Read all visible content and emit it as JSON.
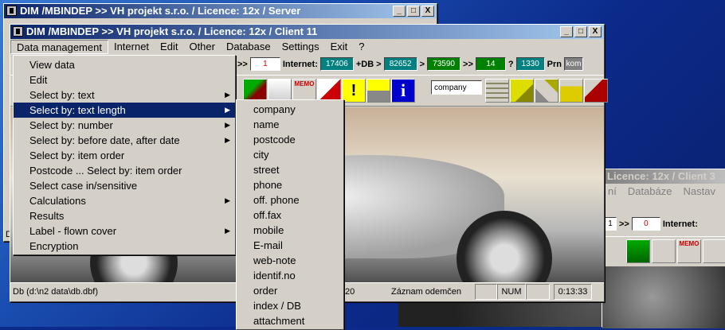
{
  "windows": {
    "server_title": "DIM /MBINDEP >> VH projekt s.r.o. / Licence: 12x / Server",
    "client_title": "DIM /MBINDEP >> VH projekt s.r.o. / Licence: 12x / Client 11",
    "client3_title": "Licence: 12x / Client 3",
    "min": "_",
    "max": "□",
    "close": "X"
  },
  "menubar": [
    "Data management",
    "Internet",
    "Edit",
    "Other",
    "Database",
    "Settings",
    "Exit",
    "?"
  ],
  "menu_data_management": [
    {
      "label": "View data",
      "sub": false
    },
    {
      "label": "Edit",
      "sub": false
    },
    {
      "label": "Select by: text",
      "sub": true
    },
    {
      "label": "Select by: text length",
      "sub": true
    },
    {
      "label": "Select by: number",
      "sub": true
    },
    {
      "label": "Select by: before date, after date",
      "sub": true
    },
    {
      "label": "Select by: item order",
      "sub": false
    },
    {
      "label": "Postcode ... Select by: item order",
      "sub": false
    },
    {
      "label": "Select case in/sensitive",
      "sub": false
    },
    {
      "label": "Calculations",
      "sub": true
    },
    {
      "label": "Results",
      "sub": false
    },
    {
      "label": "Label - flown cover",
      "sub": true
    },
    {
      "label": "Encryption",
      "sub": false
    }
  ],
  "submenu_text_length": [
    "company",
    "name",
    "postcode",
    "city",
    "street",
    "phone",
    "off. phone",
    "off.fax",
    "mobile",
    "E-mail",
    "web-note",
    "identif.no",
    "order",
    "index / DB",
    "attachment"
  ],
  "counters": {
    "arrows": ">>",
    "current": "1",
    "internet_label": "Internet:",
    "internet_value": "17406",
    "db_label": "+DB",
    "gt": ">",
    "db_value": "82652",
    "v3": "73590",
    "arrows2": ">>",
    "v4": "14",
    "q": "?",
    "v5": "1330",
    "prn": "Prn",
    "kom": "kom"
  },
  "search_field": "company",
  "status": {
    "path": "Db (d:\\n2 data\\db.dbf)",
    "num": "20",
    "lock": "Záznam odemčen",
    "numlock": "NUM",
    "time": "0:13:33"
  },
  "client3": {
    "menu": [
      "ní",
      "Databáze",
      "Nastav"
    ],
    "arrows": ">>",
    "one": "1",
    "zero": "0",
    "internet": "Internet:"
  },
  "memo_label": "MEMO",
  "info_glyph": "i",
  "excl_glyph": "!",
  "server_d": "D"
}
